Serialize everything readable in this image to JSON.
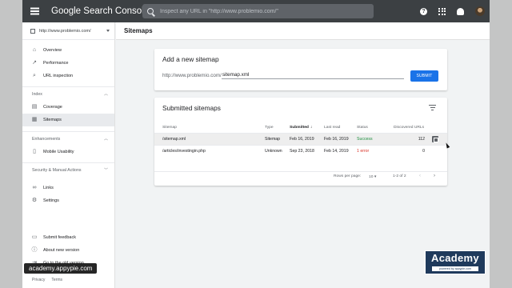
{
  "app": {
    "brand": "Google Search Console"
  },
  "search": {
    "placeholder": "Inspect any URL in \"http://www.problemio.com/\""
  },
  "topbar_icons": [
    "help-icon",
    "apps-icon",
    "notifications-icon",
    "account-avatar"
  ],
  "property": {
    "url": "http://www.problemio.com/"
  },
  "sidebar": {
    "items": [
      {
        "label": "Overview",
        "icon": "home-icon"
      },
      {
        "label": "Performance",
        "icon": "trending-icon"
      },
      {
        "label": "URL inspection",
        "icon": "search-icon"
      }
    ],
    "index_section": {
      "label": "Index",
      "items": [
        {
          "label": "Coverage",
          "icon": "coverage-icon"
        },
        {
          "label": "Sitemaps",
          "icon": "sitemaps-icon",
          "active": true
        }
      ]
    },
    "enhancements_section": {
      "label": "Enhancements",
      "items": [
        {
          "label": "Mobile Usability",
          "icon": "phone-icon"
        }
      ]
    },
    "security_section": {
      "label": "Security & Manual Actions"
    },
    "extra_items": [
      {
        "label": "Links",
        "icon": "links-icon"
      },
      {
        "label": "Settings",
        "icon": "settings-icon"
      }
    ],
    "footer_items": [
      {
        "label": "Submit feedback",
        "icon": "feedback-icon"
      },
      {
        "label": "About new version",
        "icon": "info-icon"
      },
      {
        "label": "Go to the old version",
        "icon": "exit-icon"
      }
    ],
    "bottom_links": [
      "Privacy",
      "Terms"
    ]
  },
  "page": {
    "title": "Sitemaps"
  },
  "add_sitemap": {
    "title": "Add a new sitemap",
    "url_prefix": "http://www.problemio.com/",
    "input_value": "sitemap.xml",
    "submit_label": "SUBMIT"
  },
  "submitted": {
    "title": "Submitted sitemaps",
    "columns": [
      "Sitemap",
      "Type",
      "Submitted",
      "Last read",
      "Status",
      "Discovered URLs"
    ],
    "rows": [
      {
        "sitemap": "/sitemap.xml",
        "type": "Sitemap",
        "submitted": "Feb 16, 2019",
        "last_read": "Feb 16, 2019",
        "status": "Success",
        "discovered": "112"
      },
      {
        "sitemap": "/articles/investingin.php",
        "type": "Unknown",
        "submitted": "Sep 23, 2018",
        "last_read": "Feb 14, 2019",
        "status": "1 error",
        "discovered": "0"
      }
    ],
    "pagination": {
      "rows_label": "Rows per page:",
      "rows_value": "10",
      "range": "1-2 of 2"
    }
  },
  "colors": {
    "primary": "#1a73e8",
    "success": "#1e8e3e",
    "error": "#d93025",
    "topbar": "#3c4043"
  },
  "watermark": {
    "left_text": "academy.appypie.com",
    "right_title": "Academy",
    "right_sub": "powered by appypie.com"
  }
}
